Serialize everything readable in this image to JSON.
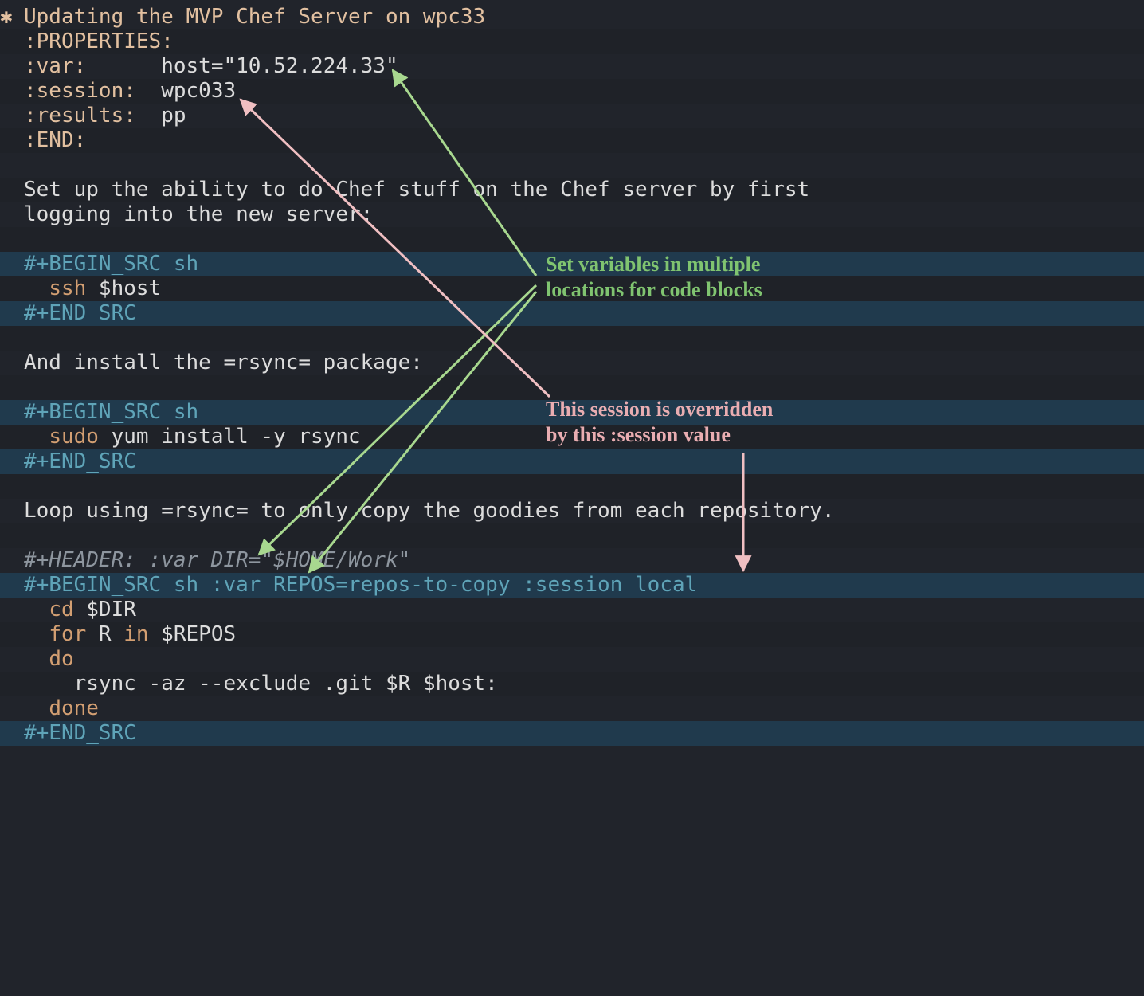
{
  "colors": {
    "bg": "#21242b",
    "stripe_dark": "#1f2228",
    "stripe_blue": "#203a4d",
    "heading": "#e2c0a0",
    "body": "#dcdcdc",
    "meta": "#5fa4b8",
    "code_fn": "#d39f72",
    "comment": "#8e969f",
    "annot_green": "#80c470",
    "annot_pink": "#e9adb1"
  },
  "heading": {
    "bullet": "✱",
    "title": "Updating the MVP Chef Server on wpc33"
  },
  "properties": {
    "open": ":PROPERTIES:",
    "var_key": ":var:",
    "var_val": "host=\"10.52.224.33\"",
    "session_key": ":session:",
    "session_val": "wpc033",
    "results_key": ":results:",
    "results_val": "pp",
    "end": ":END:"
  },
  "para1_l1": "Set up the ability to do Chef stuff on the Chef server by first",
  "para1_l2": "logging into the new server:",
  "block1": {
    "begin": "#+BEGIN_SRC sh",
    "code_fn": "ssh",
    "code_rest": " $host",
    "end": "#+END_SRC"
  },
  "para2_a": "And install the ",
  "para2_code": "=rsync=",
  "para2_b": " package:",
  "block2": {
    "begin": "#+BEGIN_SRC sh",
    "code_fn": "sudo",
    "code_rest": " yum install -y rsync",
    "end": "#+END_SRC"
  },
  "para3_a": "Loop using ",
  "para3_code": "=rsync=",
  "para3_b": " to only copy the goodies from each repository.",
  "header_line": "#+HEADER: :var DIR=\"$HOME/Work\"",
  "block3": {
    "begin": "#+BEGIN_SRC sh :var REPOS=repos-to-copy :session local",
    "l1_fn": "cd",
    "l1_rest": " $DIR",
    "l2_fn": "for",
    "l2_mid": " R ",
    "l2_in": "in",
    "l2_rest": " $REPOS",
    "l3_fn": "do",
    "l4": "  rsync -az --exclude .git $R $host:",
    "l5_fn": "done",
    "end": "#+END_SRC"
  },
  "annotations": {
    "a1_l1": "Set variables in multiple",
    "a1_l2": "locations for code blocks",
    "a2_l1": "This session is overridden",
    "a2_l2": "by this :session value"
  }
}
